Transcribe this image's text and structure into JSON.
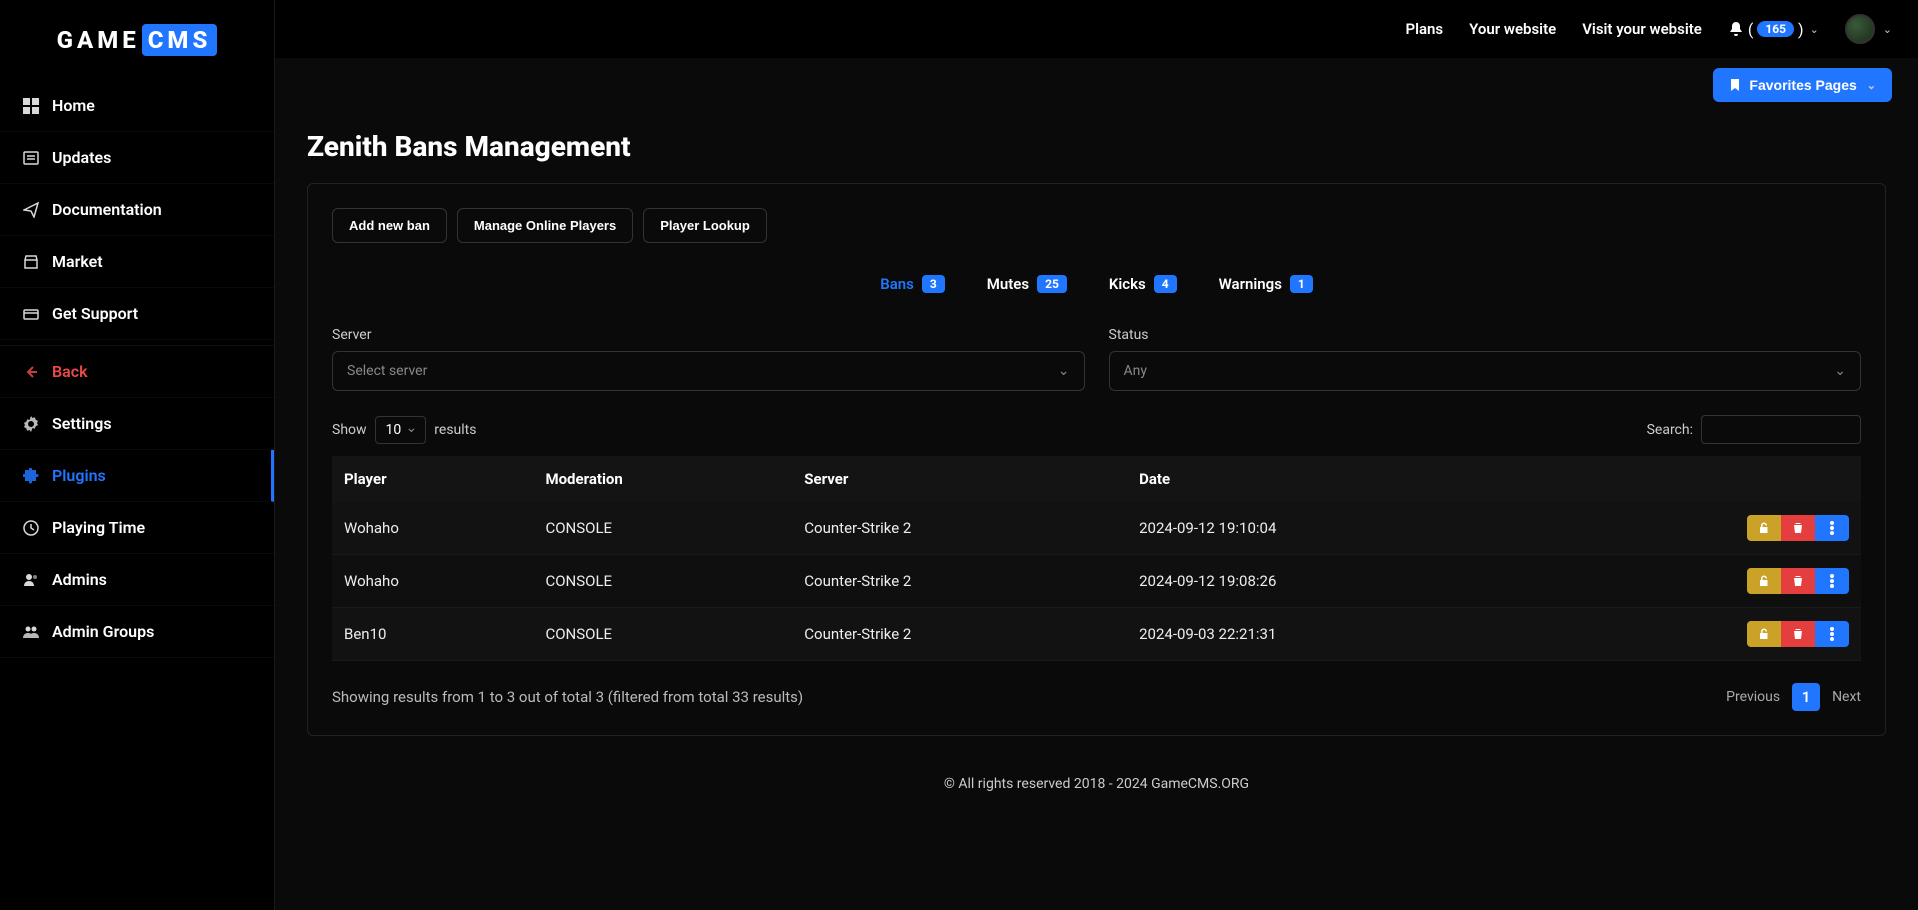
{
  "logo": {
    "part1": "GAME",
    "part2": "CMS"
  },
  "sidebar": {
    "items": [
      {
        "label": "Home",
        "icon": "grid-icon"
      },
      {
        "label": "Updates",
        "icon": "newspaper-icon"
      },
      {
        "label": "Documentation",
        "icon": "paperplane-icon"
      },
      {
        "label": "Market",
        "icon": "store-icon"
      },
      {
        "label": "Get Support",
        "icon": "card-icon"
      }
    ],
    "back": {
      "label": "Back",
      "icon": "arrow-left-icon"
    },
    "items2": [
      {
        "label": "Settings",
        "icon": "gear-icon"
      },
      {
        "label": "Plugins",
        "icon": "puzzle-icon",
        "active": true
      },
      {
        "label": "Playing Time",
        "icon": "clock-icon"
      },
      {
        "label": "Admins",
        "icon": "users-icon"
      },
      {
        "label": "Admin Groups",
        "icon": "usergroup-icon"
      }
    ]
  },
  "topbar": {
    "links": [
      "Plans",
      "Your website",
      "Visit your website"
    ],
    "notif_count": "165",
    "favorites_label": "Favorites Pages"
  },
  "page": {
    "title": "Zenith Bans Management"
  },
  "actions": {
    "add_ban": "Add new ban",
    "manage_online": "Manage Online Players",
    "player_lookup": "Player Lookup"
  },
  "tabs": [
    {
      "label": "Bans",
      "count": "3",
      "active": true
    },
    {
      "label": "Mutes",
      "count": "25"
    },
    {
      "label": "Kicks",
      "count": "4"
    },
    {
      "label": "Warnings",
      "count": "1"
    }
  ],
  "filters": {
    "server": {
      "label": "Server",
      "value": "Select server"
    },
    "status": {
      "label": "Status",
      "value": "Any"
    }
  },
  "table_ctrl": {
    "show_label": "Show",
    "show_value": "10",
    "results_label": "results",
    "search_label": "Search:"
  },
  "table": {
    "headers": [
      "Player",
      "Moderation",
      "Server",
      "Date"
    ],
    "rows": [
      {
        "player": "Wohaho",
        "moderation": "CONSOLE",
        "server": "Counter-Strike 2",
        "date": "2024-09-12 19:10:04"
      },
      {
        "player": "Wohaho",
        "moderation": "CONSOLE",
        "server": "Counter-Strike 2",
        "date": "2024-09-12 19:08:26"
      },
      {
        "player": "Ben10",
        "moderation": "CONSOLE",
        "server": "Counter-Strike 2",
        "date": "2024-09-03 22:21:31"
      }
    ]
  },
  "table_footer": {
    "summary": "Showing results from 1 to 3 out of total 3 (filtered from total 33 results)",
    "prev": "Previous",
    "page": "1",
    "next": "Next"
  },
  "footer": "© All rights reserved 2018 - 2024 GameCMS.ORG"
}
